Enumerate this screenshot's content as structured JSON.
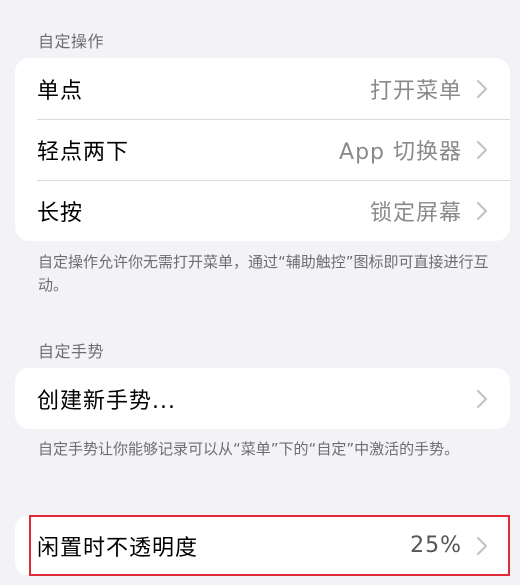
{
  "sections": {
    "custom_actions": {
      "header": "自定操作",
      "rows": [
        {
          "label": "单点",
          "value": "打开菜单"
        },
        {
          "label": "轻点两下",
          "value": "App 切换器"
        },
        {
          "label": "长按",
          "value": "锁定屏幕"
        }
      ],
      "footer": "自定操作允许你无需打开菜单，通过“辅助触控”图标即可直接进行互动。"
    },
    "custom_gestures": {
      "header": "自定手势",
      "rows": [
        {
          "label": "创建新手势..."
        }
      ],
      "footer": "自定手势让你能够记录可以从“菜单”下的“自定”中激活的手势。"
    },
    "idle_opacity": {
      "label": "闲置时不透明度",
      "value": "25%"
    }
  },
  "colors": {
    "background": "#f2f2f7",
    "highlight": "#e02a35"
  }
}
